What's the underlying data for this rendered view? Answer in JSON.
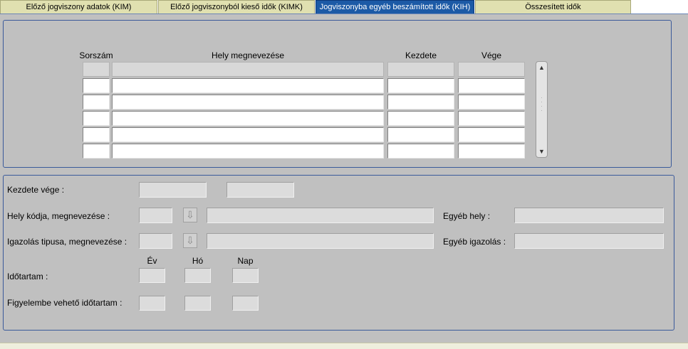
{
  "tabs": [
    {
      "label": "Előző jogviszony adatok (KIM)",
      "active": false
    },
    {
      "label": "Előző jogviszonyból kieső idők (KIMK)",
      "active": false
    },
    {
      "label": "Jogviszonyba egyéb beszámított idők (KIH)",
      "active": true
    },
    {
      "label": "Összesített idők",
      "active": false
    }
  ],
  "grid": {
    "headers": {
      "sorszam": "Sorszám",
      "hely": "Hely megnevezése",
      "kezdete": "Kezdete",
      "vege": "Vége"
    },
    "rows": [
      {
        "sorszam": "",
        "hely": "",
        "kezdete": "",
        "vege": ""
      },
      {
        "sorszam": "",
        "hely": "",
        "kezdete": "",
        "vege": ""
      },
      {
        "sorszam": "",
        "hely": "",
        "kezdete": "",
        "vege": ""
      },
      {
        "sorszam": "",
        "hely": "",
        "kezdete": "",
        "vege": ""
      },
      {
        "sorszam": "",
        "hely": "",
        "kezdete": "",
        "vege": ""
      },
      {
        "sorszam": "",
        "hely": "",
        "kezdete": "",
        "vege": ""
      }
    ]
  },
  "detail": {
    "kezdete_vege_label": "Kezdete  vége :",
    "hely_label": "Hely kódja, megnevezése :",
    "egyeb_hely_label": "Egyéb hely :",
    "igazolas_label": "Igazolás tipusa, megnevezése :",
    "egyeb_igazolas_label": "Egyéb igazolás :",
    "ev_label": "Év",
    "ho_label": "Hó",
    "nap_label": "Nap",
    "idotartam_label": "Időtartam :",
    "figyelembe_label": "Figyelembe vehető időtartam :",
    "values": {
      "kezdete": "",
      "vege": "",
      "hely_kod": "",
      "hely_nev": "",
      "egyeb_hely": "",
      "igazolas_kod": "",
      "igazolas_nev": "",
      "egyeb_igazolas": "",
      "ido_ev": "",
      "ido_ho": "",
      "ido_nap": "",
      "figy_ev": "",
      "figy_ho": "",
      "figy_nap": ""
    }
  },
  "icons": {
    "lov_button": "down-arrow-icon",
    "scroll_up": "triangle-up-icon",
    "scroll_down": "triangle-down-icon"
  },
  "colors": {
    "background": "#c0c0c0",
    "active_tab": "#1c5aa6",
    "inactive_tab": "#e0e0b0",
    "panel_border": "#3a5a9a"
  }
}
